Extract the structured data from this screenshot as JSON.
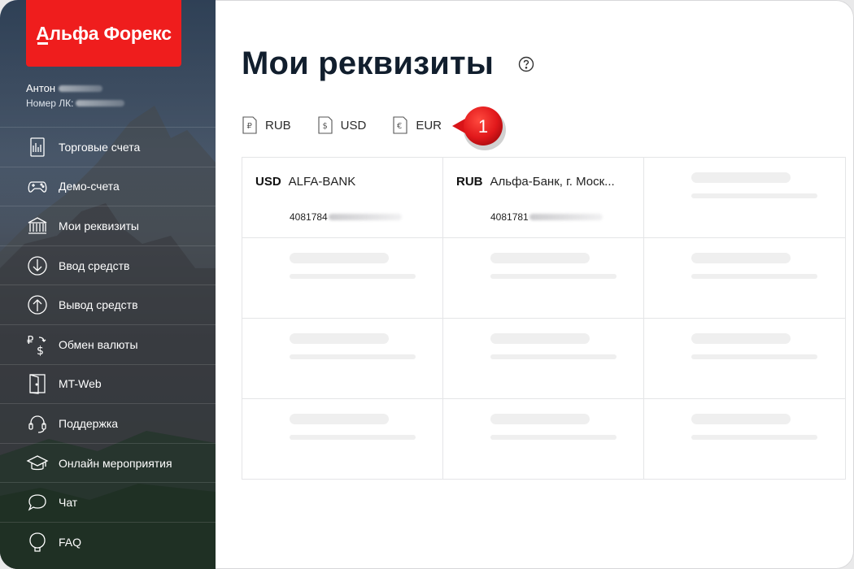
{
  "app": {
    "logo_text": "Альфа Форекс",
    "brand_color": "#ef1d1d"
  },
  "user": {
    "name": "Антон",
    "account_label": "Номер ЛК:"
  },
  "nav": {
    "items": [
      {
        "label": "Торговые счета",
        "icon": "trading-accounts-icon"
      },
      {
        "label": "Демо-счета",
        "icon": "gamepad-icon"
      },
      {
        "label": "Мои реквизиты",
        "icon": "bank-icon"
      },
      {
        "label": "Ввод средств",
        "icon": "deposit-arrow-icon"
      },
      {
        "label": "Вывод средств",
        "icon": "withdraw-arrow-icon"
      },
      {
        "label": "Обмен валюты",
        "icon": "currency-exchange-icon"
      },
      {
        "label": "MT-Web",
        "icon": "door-icon"
      },
      {
        "label": "Поддержка",
        "icon": "headset-icon"
      },
      {
        "label": "Онлайн мероприятия",
        "icon": "graduation-cap-icon"
      },
      {
        "label": "Чат",
        "icon": "chat-bubble-icon"
      },
      {
        "label": "FAQ",
        "icon": "faq-icon"
      }
    ]
  },
  "main": {
    "title": "Мои реквизиты",
    "tabs": [
      {
        "label": "RUB",
        "icon": "ruble-doc-icon"
      },
      {
        "label": "USD",
        "icon": "dollar-doc-icon"
      },
      {
        "label": "EUR",
        "icon": "euro-doc-icon"
      }
    ],
    "marker": {
      "number": "1",
      "color": "#e1181b"
    },
    "cards": [
      {
        "currency": "USD",
        "bank": "ALFA-BANK",
        "account_prefix": "4081784"
      },
      {
        "currency": "RUB",
        "bank": "Альфа-Банк, г. Моск...",
        "account_prefix": "4081781"
      }
    ]
  }
}
